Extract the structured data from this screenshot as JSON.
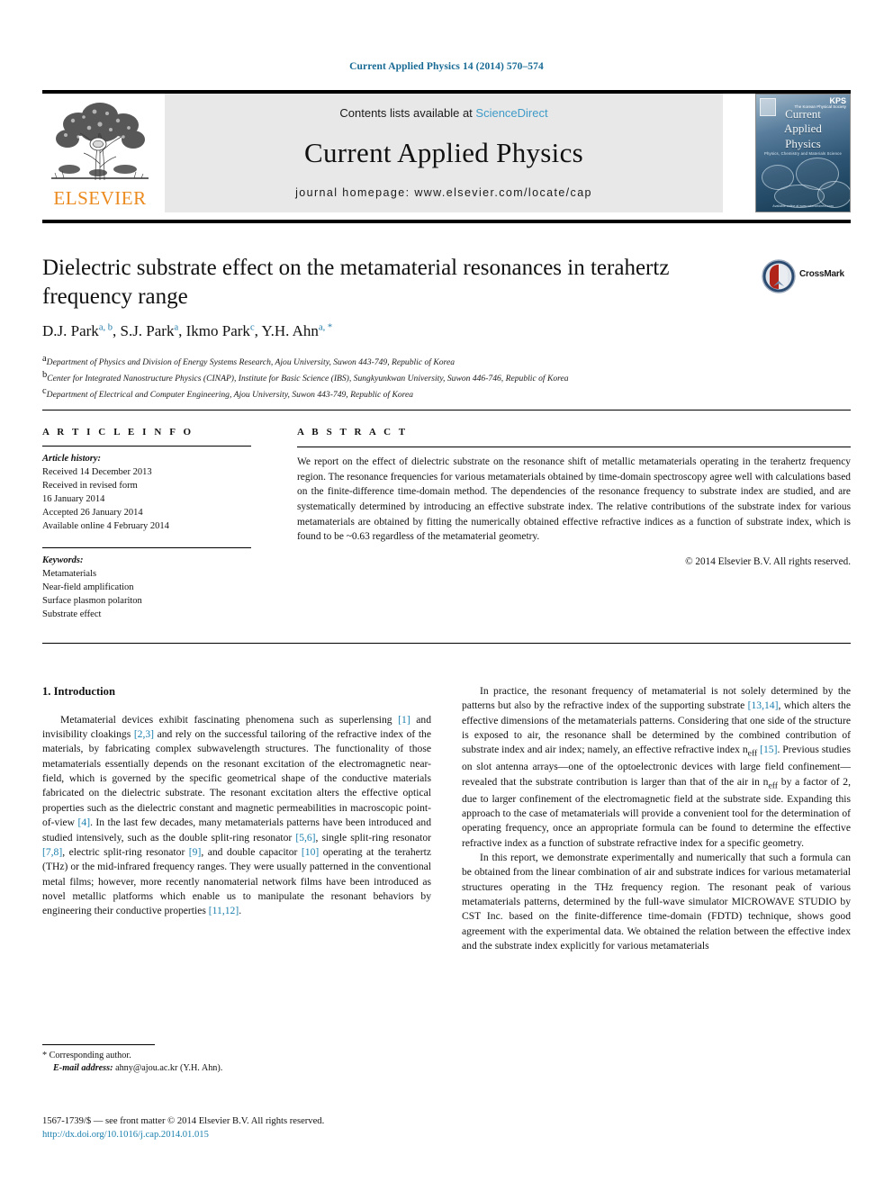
{
  "running_head": "Current Applied Physics 14 (2014) 570–574",
  "banner": {
    "contents_prefix": "Contents lists available at ",
    "sciencedirect": "ScienceDirect",
    "journal_title": "Current Applied Physics",
    "homepage": "journal homepage: www.elsevier.com/locate/cap",
    "publisher_word": "ELSEVIER",
    "cover": {
      "title_line1": "Current",
      "title_line2": "Applied",
      "title_line3": "Physics",
      "subtitle": "Physics, Chemistry and Materials Science",
      "badge": "KPS",
      "badge_sub": "The Korean Physical Society",
      "bottom": "Available online at www.sciencedirect.com"
    }
  },
  "title": "Dielectric substrate effect on the metamaterial resonances in terahertz frequency range",
  "crossmark": {
    "label": "CrossMark"
  },
  "authors": [
    {
      "name": "D.J. Park",
      "marks": "a, b"
    },
    {
      "name": "S.J. Park",
      "marks": "a"
    },
    {
      "name": "Ikmo Park",
      "marks": "c"
    },
    {
      "name": "Y.H. Ahn",
      "marks": "a, *"
    }
  ],
  "affiliations": [
    {
      "mark": "a",
      "text": "Department of Physics and Division of Energy Systems Research, Ajou University, Suwon 443-749, Republic of Korea"
    },
    {
      "mark": "b",
      "text": "Center for Integrated Nanostructure Physics (CINAP), Institute for Basic Science (IBS), Sungkyunkwan University, Suwon 446-746, Republic of Korea"
    },
    {
      "mark": "c",
      "text": "Department of Electrical and Computer Engineering, Ajou University, Suwon 443-749, Republic of Korea"
    }
  ],
  "article_info": {
    "heading": "A R T I C L E  I N F O",
    "history_label": "Article history:",
    "history": [
      "Received 14 December 2013",
      "Received in revised form",
      "16 January 2014",
      "Accepted 26 January 2014",
      "Available online 4 February 2014"
    ],
    "keywords_label": "Keywords:",
    "keywords": [
      "Metamaterials",
      "Near-field amplification",
      "Surface plasmon polariton",
      "Substrate effect"
    ]
  },
  "abstract": {
    "heading": "A B S T R A C T",
    "text": "We report on the effect of dielectric substrate on the resonance shift of metallic metamaterials operating in the terahertz frequency region. The resonance frequencies for various metamaterials obtained by time-domain spectroscopy agree well with calculations based on the finite-difference time-domain method. The dependencies of the resonance frequency to substrate index are studied, and are systematically determined by introducing an effective substrate index. The relative contributions of the substrate index for various metamaterials are obtained by fitting the numerically obtained effective refractive indices as a function of substrate index, which is found to be ~0.63 regardless of the metamaterial geometry.",
    "copyright": "© 2014 Elsevier B.V. All rights reserved."
  },
  "body": {
    "section_title": "1. Introduction",
    "left_paragraphs": [
      "Metamaterial devices exhibit fascinating phenomena such as superlensing [1] and invisibility cloakings [2,3] and rely on the successful tailoring of the refractive index of the materials, by fabricating complex subwavelength structures. The functionality of those metamaterials essentially depends on the resonant excitation of the electromagnetic near-field, which is governed by the specific geometrical shape of the conductive materials fabricated on the dielectric substrate. The resonant excitation alters the effective optical properties such as the dielectric constant and magnetic permeabilities in macroscopic point-of-view [4]. In the last few decades, many metamaterials patterns have been introduced and studied intensively, such as the double split-ring resonator [5,6], single split-ring resonator [7,8], electric split-ring resonator [9], and double capacitor [10] operating at the terahertz (THz) or the mid-infrared frequency ranges. They were usually patterned in the conventional metal films; however, more recently nanomaterial network films have been introduced as novel metallic platforms which enable us to manipulate the resonant behaviors by engineering their conductive properties [11,12]."
    ],
    "right_paragraphs": [
      "In practice, the resonant frequency of metamaterial is not solely determined by the patterns but also by the refractive index of the supporting substrate [13,14], which alters the effective dimensions of the metamaterials patterns. Considering that one side of the structure is exposed to air, the resonance shall be determined by the combined contribution of substrate index and air index; namely, an effective refractive index n_eff [15]. Previous studies on slot antenna arrays—one of the optoelectronic devices with large field confinement—revealed that the substrate contribution is larger than that of the air in n_eff by a factor of 2, due to larger confinement of the electromagnetic field at the substrate side. Expanding this approach to the case of metamaterials will provide a convenient tool for the determination of operating frequency, once an appropriate formula can be found to determine the effective refractive index as a function of substrate refractive index for a specific geometry.",
      "In this report, we demonstrate experimentally and numerically that such a formula can be obtained from the linear combination of air and substrate indices for various metamaterial structures operating in the THz frequency region. The resonant peak of various metamaterials patterns, determined by the full-wave simulator MICROWAVE STUDIO by CST Inc. based on the finite-difference time-domain (FDTD) technique, shows good agreement with the experimental data. We obtained the relation between the effective index and the substrate index explicitly for various metamaterials"
    ]
  },
  "footnote": {
    "corresponding": "* Corresponding author.",
    "email_label": "E-mail address:",
    "email": "ahny@ajou.ac.kr",
    "email_owner": "(Y.H. Ahn)."
  },
  "footer": {
    "issn_line": "1567-1739/$ — see front matter © 2014 Elsevier B.V. All rights reserved.",
    "doi": "http://dx.doi.org/10.1016/j.cap.2014.01.015"
  },
  "colors": {
    "link_blue": "#1a7fae",
    "sciencedirect_blue": "#3f9bc8",
    "elsevier_orange": "#eb8a1e",
    "running_head_blue": "#176a94",
    "crossmark_red": "#b02419",
    "crossmark_navy": "#1f3f66"
  }
}
